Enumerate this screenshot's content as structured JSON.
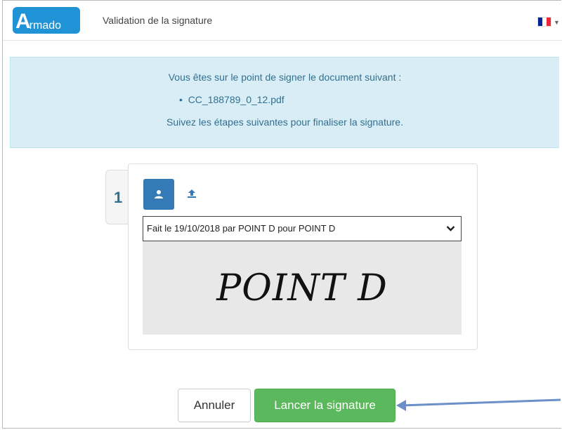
{
  "header": {
    "logo_big": "A",
    "logo_small": "rmado",
    "title": "Validation de la signature",
    "language_flag_colors": [
      "#002395",
      "#ffffff",
      "#ed2939"
    ]
  },
  "info": {
    "intro": "Vous êtes sur le point de signer le document suivant :",
    "document": "CC_188789_0_12.pdf",
    "instructions": "Suivez les étapes suivantes pour finaliser la signature."
  },
  "step": {
    "number": "1",
    "signature_select_value": "Fait le 19/10/2018 par POINT D pour POINT D",
    "signature_preview": "POINT D"
  },
  "actions": {
    "cancel_label": "Annuler",
    "launch_label": "Lancer la signature"
  },
  "colors": {
    "primary": "#337ab7",
    "success": "#5cb85c",
    "info_bg": "#d9edf7",
    "info_text": "#31708f",
    "annotation_arrow": "#6a8fc9"
  },
  "icons": [
    "person-icon",
    "upload-icon",
    "chevron-down-icon",
    "caret-down-icon",
    "french-flag-icon"
  ]
}
